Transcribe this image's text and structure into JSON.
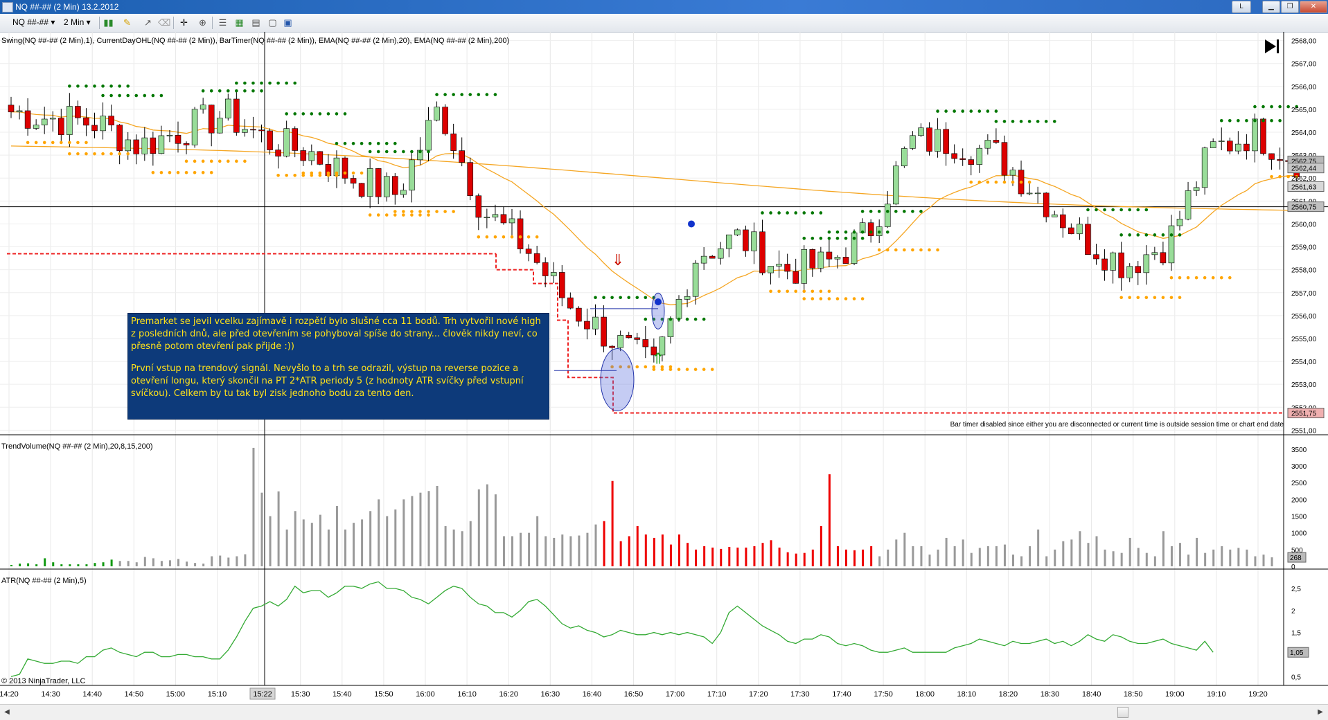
{
  "window": {
    "title": "NQ ##-## (2 Min)  13.2.2012",
    "link_button": "L",
    "minimize": "▁",
    "restore": "❐",
    "close": "✕"
  },
  "toolbar": {
    "instrument": "NQ ##-## ▾",
    "interval": "2 Min ▾",
    "icons": [
      "bar-style-icon",
      "draw-pencil-icon",
      "drawing-tools-icon",
      "eraser-icon",
      "crosshair-icon",
      "zoom-icon",
      "properties-icon",
      "indicators-icon",
      "strategies-icon",
      "data-box-icon",
      "chart-trader-icon"
    ]
  },
  "labels": {
    "price_panel": "Swing(NQ ##-## (2 Min),1), CurrentDayOHL(NQ ##-## (2 Min)), BarTimer(NQ ##-## (2 Min)), EMA(NQ ##-## (2 Min),20), EMA(NQ ##-## (2 Min),200)",
    "volume_panel": "TrendVolume(NQ ##-## (2 Min),20,8,15,200)",
    "atr_panel": "ATR(NQ ##-## (2 Min),5)",
    "bar_timer": "Bar timer disabled since either you are disconnected or current time is outside session time or chart end date",
    "copyright": "© 2013 NinjaTrader, LLC",
    "cursor_time": "15:22"
  },
  "note": {
    "paragraph1": "Premarket se jevil vcelku zajímavě i rozpětí bylo slušné cca 11 bodů. Trh vytvořil nové high z posledních dnů, ale před otevřením se pohyboval spíše do strany... člověk nikdy neví, co přesně potom otevření pak přijde :))",
    "paragraph2": "První vstup na trendový signál. Nevyšlo to a trh se odrazil, výstup na reverse pozice a otevření longu, který skončil na PT 2*ATR periody 5 (z hodnoty ATR svíčky před vstupní svíčkou).  Celkem by tu tak byl zisk jednoho bodu za tento den."
  },
  "colors": {
    "up_candle": "#99dd99",
    "down_candle": "#dd0000",
    "swing_high": "#007700",
    "swing_low": "#ffa500",
    "ema": "#f5a623",
    "ohl_line": "#ee2222",
    "volume_neutral": "#999999",
    "volume_down": "#ee0000",
    "atr_line": "#33aa33",
    "note_bg": "#0d3a7a",
    "note_text": "#ffe21a"
  },
  "chart_data": [
    {
      "type": "candlestick",
      "title": "NQ ##-## (2 Min)",
      "x": [
        "14:20",
        "14:30",
        "14:40",
        "14:50",
        "15:00",
        "15:10",
        "15:20",
        "15:30",
        "15:40",
        "15:50",
        "16:00",
        "16:10",
        "16:20",
        "16:30",
        "16:40",
        "16:50",
        "17:00",
        "17:10",
        "17:20",
        "17:30",
        "17:40",
        "17:50",
        "18:00",
        "18:10",
        "18:20",
        "18:30",
        "18:40",
        "18:50",
        "19:00",
        "19:10",
        "19:20"
      ],
      "close": [
        2564.9,
        2564.6,
        2564.4,
        2563.4,
        2564.1,
        2564.8,
        2563.6,
        2563.1,
        2562.0,
        2561.3,
        2565.1,
        2560.6,
        2559.0,
        2556.5,
        2555.0,
        2553.7,
        2558.7,
        2559.4,
        2558.0,
        2558.2,
        2559.6,
        2563.6,
        2563.6,
        2563.0,
        2561.3,
        2559.4,
        2558.2,
        2559.2,
        2563.2,
        2564.0,
        2562.8
      ],
      "y_ticks": [
        "2551,00",
        "2552,00",
        "2553,00",
        "2554,00",
        "2555,00",
        "2556,00",
        "2557,00",
        "2558,00",
        "2559,00",
        "2560,00",
        "2561,00",
        "2562,00",
        "2563,00",
        "2564,00",
        "2565,00",
        "2566,00",
        "2567,00",
        "2568,00"
      ],
      "ylim": [
        2550.8,
        2568.2
      ],
      "price_markers": [
        "2562,75",
        "2562,44",
        "2561,63",
        "2560,75",
        "2551,75"
      ],
      "annotations": [
        "EMA 20",
        "EMA 200",
        "Swing high/low dots",
        "CurrentDayOHL dashed low"
      ]
    },
    {
      "type": "bar",
      "title": "TrendVolume",
      "y_ticks": [
        "0",
        "500",
        "1000",
        "1500",
        "2000",
        "2500",
        "3000",
        "3500"
      ],
      "ylim": [
        0,
        3600
      ],
      "last_value": "268",
      "values": [
        40,
        80,
        90,
        60,
        240,
        120,
        60,
        60,
        60,
        60,
        100,
        120,
        200,
        160,
        160,
        120,
        280,
        240,
        160,
        180,
        220,
        140,
        100,
        80,
        300,
        320,
        260,
        300,
        360,
        3540,
        2200,
        1500,
        2240,
        1100,
        1650,
        1400,
        1300,
        1540,
        1100,
        1800,
        1100,
        1300,
        1400,
        1650,
        2000,
        1500,
        1700,
        2000,
        2100,
        2200,
        2250,
        2400,
        1200,
        1100,
        1050,
        1350,
        2300,
        2450,
        2150,
        900,
        900,
        1000,
        1000,
        1500,
        900,
        850,
        950,
        900,
        920,
        1000,
        1250,
        1350,
        2550,
        750,
        900,
        1200,
        950,
        850,
        950,
        650,
        950,
        700,
        500,
        600,
        560,
        520,
        580,
        560,
        560,
        600,
        700,
        780,
        560,
        420,
        380,
        400,
        500,
        1200,
        2750,
        600,
        500,
        480,
        500,
        600,
        300,
        500,
        800,
        1000,
        600,
        600,
        350,
        500,
        850,
        600,
        800,
        400,
        550,
        600,
        600,
        650,
        350,
        300,
        600,
        1100,
        300,
        500,
        750,
        800,
        1050,
        700,
        900,
        500,
        450,
        400,
        850,
        550,
        400,
        300,
        1050,
        600,
        700,
        350,
        850,
        400,
        500,
        600,
        500,
        550,
        500,
        300,
        350,
        268
      ]
    },
    {
      "type": "line",
      "title": "ATR",
      "y_ticks": [
        "0,5",
        "1",
        "1,5",
        "2",
        "2,5"
      ],
      "ylim": [
        0.3,
        2.75
      ],
      "last_value": "1,05",
      "values": [
        0.5,
        0.55,
        0.9,
        0.85,
        0.8,
        0.8,
        0.85,
        0.85,
        0.8,
        0.95,
        0.95,
        1.1,
        1.15,
        1.05,
        1.0,
        0.95,
        1.05,
        1.05,
        0.95,
        0.95,
        1.0,
        1.0,
        0.95,
        0.95,
        0.9,
        0.9,
        1.1,
        1.4,
        1.75,
        2.05,
        2.1,
        2.2,
        2.1,
        2.25,
        2.55,
        2.4,
        2.45,
        2.45,
        2.3,
        2.4,
        2.55,
        2.55,
        2.5,
        2.6,
        2.65,
        2.5,
        2.5,
        2.45,
        2.3,
        2.25,
        2.15,
        2.3,
        2.45,
        2.55,
        2.5,
        2.3,
        2.15,
        2.1,
        1.95,
        1.95,
        1.85,
        2.0,
        2.2,
        2.25,
        2.1,
        1.9,
        1.7,
        1.6,
        1.65,
        1.55,
        1.5,
        1.4,
        1.45,
        1.55,
        1.5,
        1.45,
        1.45,
        1.5,
        1.45,
        1.5,
        1.45,
        1.5,
        1.45,
        1.4,
        1.25,
        1.5,
        1.95,
        2.1,
        1.95,
        1.8,
        1.65,
        1.55,
        1.45,
        1.3,
        1.25,
        1.35,
        1.35,
        1.45,
        1.4,
        1.25,
        1.2,
        1.25,
        1.2,
        1.1,
        1.05,
        1.05,
        1.1,
        1.15,
        1.05,
        1.05,
        1.05,
        1.05,
        1.05,
        1.15,
        1.2,
        1.25,
        1.35,
        1.3,
        1.25,
        1.2,
        1.3,
        1.25,
        1.25,
        1.3,
        1.35,
        1.25,
        1.3,
        1.2,
        1.3,
        1.45,
        1.35,
        1.3,
        1.45,
        1.4,
        1.3,
        1.25,
        1.25,
        1.3,
        1.35,
        1.25,
        1.2,
        1.15,
        1.1,
        1.3,
        1.05
      ]
    }
  ]
}
